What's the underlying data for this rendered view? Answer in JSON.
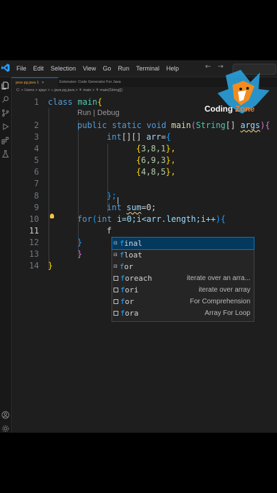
{
  "menu": [
    "File",
    "Edit",
    "Selection",
    "View",
    "Go",
    "Run",
    "Terminal",
    "Help"
  ],
  "tabs": [
    {
      "label": "java pg.java 1",
      "close": "×"
    },
    {
      "label": "Extension: Code Generator For Java"
    }
  ],
  "breadcrumb": "C: > Users > ajayr > ⌂ java pg.java > ⚘ main > ⚘ main(String[])",
  "line_numbers": [
    "1",
    "2",
    "3",
    "4",
    "5",
    "6",
    "7",
    "8",
    "9",
    "10",
    "11",
    "12",
    "13",
    "14"
  ],
  "codelens": "Run | Debug",
  "code": {
    "l1_kw": "class",
    "l1_name": "main",
    "l1_brace": "{",
    "l2_mod": "public static void",
    "l2_fn": "main",
    "l2_type": "String",
    "l2_arr": "[]",
    "l2_arg": "args",
    "l2_brace": "{",
    "l3_type": "int",
    "l3_dims": "[][]",
    "l3_var": "arr",
    "l3_eq": "=",
    "l3_brace": "{",
    "l4_open": "{",
    "l4_vals": "3,8,1",
    "l4_close": "},",
    "l5_open": "{",
    "l5_vals": "6,9,3",
    "l5_close": "},",
    "l6_open": "{",
    "l6_vals": "4,8,5",
    "l6_close": "},",
    "l8_close": "};",
    "l9_type": "int",
    "l9_var": "sum",
    "l9_rest": "=0;",
    "l10_kw": "for",
    "l10_p1": "(",
    "l10_type": "int",
    "l10_rest": " i=0;i<arr.length;i++",
    "l10_p2": ")",
    "l10_brace": "{",
    "l11_typed": "f",
    "l12_brace": "}",
    "l13_brace": "}",
    "l14_brace": "}"
  },
  "suggestions": [
    {
      "prefix": "f",
      "rest": "inal",
      "detail": ""
    },
    {
      "prefix": "f",
      "rest": "loat",
      "detail": ""
    },
    {
      "prefix": "f",
      "rest": "or",
      "detail": ""
    },
    {
      "prefix": "f",
      "rest": "oreach",
      "detail": "iterate over an arra..."
    },
    {
      "prefix": "f",
      "rest": "ori",
      "detail": "iterate over array"
    },
    {
      "prefix": "f",
      "rest": "or",
      "detail": "For Comprehension"
    },
    {
      "prefix": "f",
      "rest": "ora",
      "detail": "Array For Loop"
    }
  ],
  "watermark": {
    "text1": "Coding",
    "text2": "Zone"
  },
  "colors": {
    "accent": "#0078d4",
    "selection": "#04395e",
    "keyword": "#569cd6",
    "type": "#4ec9b0",
    "function": "#dcdcaa",
    "variable": "#9cdcfe"
  }
}
